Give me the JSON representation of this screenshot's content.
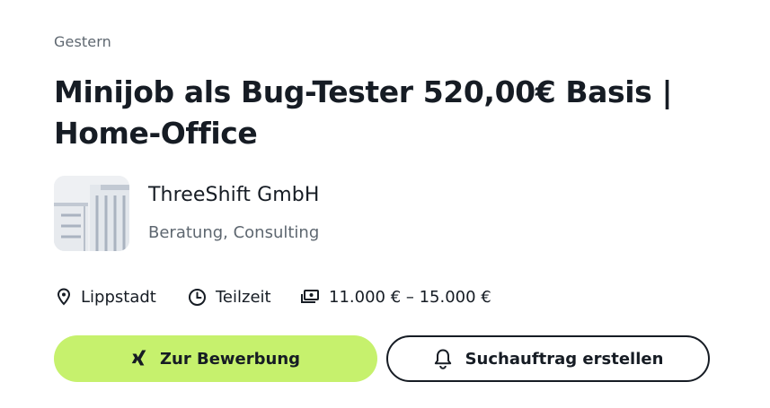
{
  "posted": "Gestern",
  "job": {
    "title": "Minijob als Bug-Tester 520,00€ Basis | Home-Office"
  },
  "company": {
    "name": "ThreeShift GmbH",
    "industry": "Beratung, Consulting",
    "logo_icon": "building-logo-icon"
  },
  "meta": {
    "location": "Lippstadt",
    "employment_type": "Teilzeit",
    "salary": "11.000 € – 15.000 €",
    "location_icon": "location-pin-icon",
    "employment_icon": "clock-icon",
    "salary_icon": "money-icon"
  },
  "actions": {
    "apply_label": "Zur Bewerbung",
    "apply_icon": "xing-icon",
    "alert_label": "Suchauftrag erstellen",
    "alert_icon": "bell-icon"
  },
  "colors": {
    "apply_button_bg": "#c6f16d",
    "text_primary": "#161c24",
    "text_secondary": "#5e6770"
  }
}
